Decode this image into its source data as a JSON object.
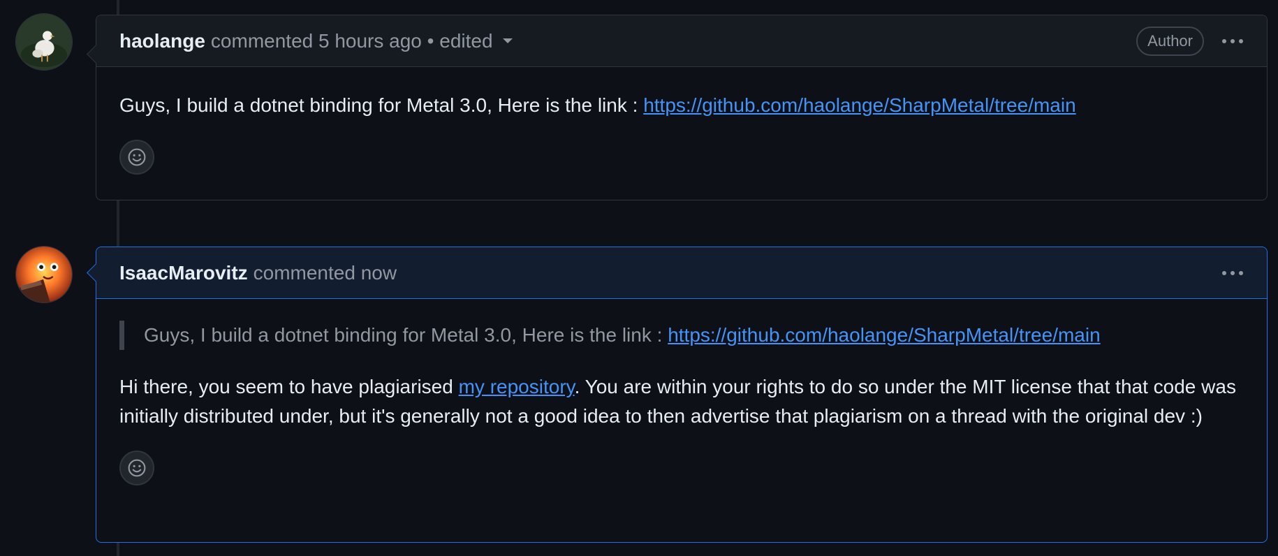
{
  "comments": [
    {
      "author": "haolange",
      "meta": "commented 5 hours ago • edited",
      "badge": "Author",
      "body": {
        "text": "Guys, I build a dotnet binding for Metal 3.0, Here is the link : ",
        "link": "https://github.com/haolange/SharpMetal/tree/main"
      }
    },
    {
      "author": "IsaacMarovitz",
      "meta": "commented now",
      "quote": {
        "text": "Guys, I build a dotnet binding for Metal 3.0, Here is the link : ",
        "link": "https://github.com/haolange/SharpMetal/tree/main"
      },
      "body": {
        "before": "Hi there, you seem to have plagiarised ",
        "link": "my repository",
        "after": ". You are within your rights to do so under the MIT license that that code was initially distributed under, but it's generally not a good idea to then advertise that plagiarism on a thread with the original dev :)"
      }
    }
  ],
  "icons": {
    "reaction": "smiley-icon",
    "menu": "kebab-horizontal-icon",
    "edited_dropdown": "triangle-down-icon"
  },
  "colors": {
    "background": "#0d1117",
    "link": "#4493f8",
    "highlight_border": "#1f6feb"
  }
}
